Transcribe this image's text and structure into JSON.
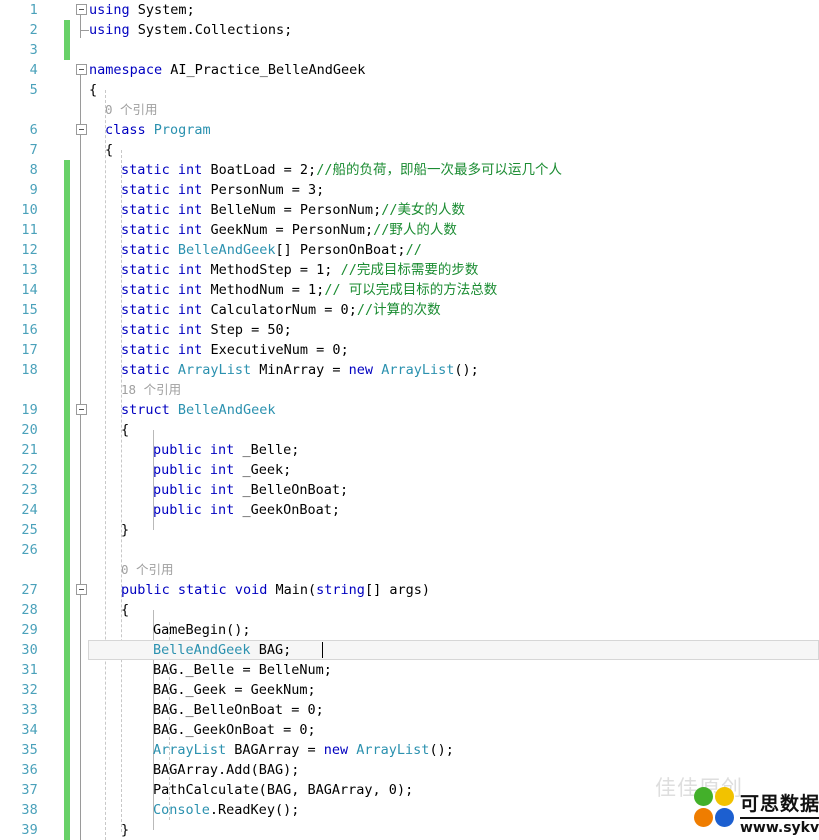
{
  "editor": {
    "app": "code-editor",
    "language": "csharp",
    "first_line": 1,
    "last_line": 39,
    "current_line": 30,
    "line_height": 20,
    "colors": {
      "background": "#ffffff",
      "line_number": "#2b91af",
      "keyword": "#0000c0",
      "type": "#2b91af",
      "comment": "#1b8c32",
      "codelens": "#a0a0a0",
      "change_bar": "#68d168",
      "current_line_bg": "#f6f6f6",
      "indent_guide": "#c8c8c8"
    }
  },
  "line_numbers": [
    1,
    2,
    3,
    4,
    5,
    6,
    7,
    8,
    9,
    10,
    11,
    12,
    13,
    14,
    15,
    16,
    17,
    18,
    19,
    20,
    21,
    22,
    23,
    24,
    25,
    26,
    27,
    28,
    29,
    30,
    31,
    32,
    33,
    34,
    35,
    36,
    37,
    38,
    39
  ],
  "codelens": [
    {
      "line": 6,
      "text": "0 个引用",
      "count": 0,
      "label": "个引用"
    },
    {
      "line": 19,
      "text": "18 个引用",
      "count": 18,
      "label": "个引用"
    },
    {
      "line": 27,
      "text": "0 个引用",
      "count": 0,
      "label": "个引用"
    }
  ],
  "lines": [
    {
      "n": 1,
      "indent": 0,
      "text": "using System;"
    },
    {
      "n": 2,
      "indent": 0,
      "text": "using System.Collections;"
    },
    {
      "n": 3,
      "indent": 0,
      "text": ""
    },
    {
      "n": 4,
      "indent": 0,
      "text": "namespace AI_Practice_BelleAndGeek"
    },
    {
      "n": 5,
      "indent": 1,
      "text": "{"
    },
    {
      "n": 6,
      "indent": 2,
      "text": "class Program"
    },
    {
      "n": 7,
      "indent": 2,
      "text": "{"
    },
    {
      "n": 8,
      "indent": 3,
      "text": "static int BoatLoad = 2;//船的负荷，即船一次最多可以运几个人"
    },
    {
      "n": 9,
      "indent": 3,
      "text": "static int PersonNum = 3;"
    },
    {
      "n": 10,
      "indent": 3,
      "text": "static int BelleNum = PersonNum;//美女的人数"
    },
    {
      "n": 11,
      "indent": 3,
      "text": "static int GeekNum = PersonNum;//野人的人数"
    },
    {
      "n": 12,
      "indent": 3,
      "text": "static BelleAndGeek[] PersonOnBoat;//"
    },
    {
      "n": 13,
      "indent": 3,
      "text": "static int MethodStep = 1; //完成目标需要的步数"
    },
    {
      "n": 14,
      "indent": 3,
      "text": "static int MethodNum = 1;// 可以完成目标的方法总数"
    },
    {
      "n": 15,
      "indent": 3,
      "text": "static int CalculatorNum = 0;//计算的次数"
    },
    {
      "n": 16,
      "indent": 3,
      "text": "static int Step = 50;"
    },
    {
      "n": 17,
      "indent": 3,
      "text": "static int ExecutiveNum = 0;"
    },
    {
      "n": 18,
      "indent": 3,
      "text": "static ArrayList MinArray = new ArrayList();"
    },
    {
      "n": 19,
      "indent": 3,
      "text": "struct BelleAndGeek"
    },
    {
      "n": 20,
      "indent": 3,
      "text": "{"
    },
    {
      "n": 21,
      "indent": 4,
      "text": "public int _Belle;"
    },
    {
      "n": 22,
      "indent": 4,
      "text": "public int _Geek;"
    },
    {
      "n": 23,
      "indent": 4,
      "text": "public int _BelleOnBoat;"
    },
    {
      "n": 24,
      "indent": 4,
      "text": "public int _GeekOnBoat;"
    },
    {
      "n": 25,
      "indent": 3,
      "text": "}"
    },
    {
      "n": 26,
      "indent": 0,
      "text": ""
    },
    {
      "n": 27,
      "indent": 3,
      "text": "public static void Main(string[] args)"
    },
    {
      "n": 28,
      "indent": 3,
      "text": "{"
    },
    {
      "n": 29,
      "indent": 4,
      "text": "GameBegin();"
    },
    {
      "n": 30,
      "indent": 4,
      "text": "BelleAndGeek BAG;"
    },
    {
      "n": 31,
      "indent": 4,
      "text": "BAG._Belle = BelleNum;"
    },
    {
      "n": 32,
      "indent": 4,
      "text": "BAG._Geek = GeekNum;"
    },
    {
      "n": 33,
      "indent": 4,
      "text": "BAG._BelleOnBoat = 0;"
    },
    {
      "n": 34,
      "indent": 4,
      "text": "BAG._GeekOnBoat = 0;"
    },
    {
      "n": 35,
      "indent": 4,
      "text": "ArrayList BAGArray = new ArrayList();"
    },
    {
      "n": 36,
      "indent": 4,
      "text": "BAGArray.Add(BAG);"
    },
    {
      "n": 37,
      "indent": 4,
      "text": "PathCalculate(BAG, BAGArray, 0);"
    },
    {
      "n": 38,
      "indent": 4,
      "text": "Console.ReadKey();"
    },
    {
      "n": 39,
      "indent": 3,
      "text": "}"
    }
  ],
  "fold_markers": [
    {
      "line": 1,
      "state": "expanded",
      "glyph": "minus"
    },
    {
      "line": 4,
      "state": "expanded",
      "glyph": "minus"
    },
    {
      "line": 6,
      "state": "expanded",
      "glyph": "minus"
    },
    {
      "line": 19,
      "state": "expanded",
      "glyph": "minus"
    },
    {
      "line": 27,
      "state": "expanded",
      "glyph": "minus"
    }
  ],
  "change_bars": [
    {
      "from_line": 2,
      "to_line": 3
    },
    {
      "from_line": 8,
      "to_line": 39
    }
  ],
  "watermark": {
    "faint_text": "佳佳原创",
    "brand_cn": "可思数据",
    "brand_url": "www.sykv.com",
    "dot_colors": [
      "#43b02a",
      "#f2c200",
      "#ef7d00",
      "#1c5fd0"
    ]
  }
}
